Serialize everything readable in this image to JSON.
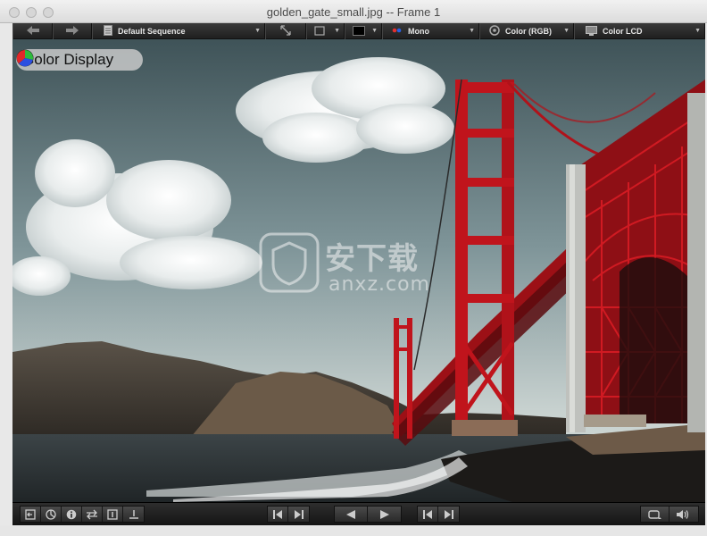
{
  "window": {
    "title": "golden_gate_small.jpg -- Frame 1"
  },
  "toolbar": {
    "sequence_label": "Default Sequence",
    "channel_label": "Mono",
    "color_mode_label": "Color (RGB)",
    "display_profile_label": "Color LCD"
  },
  "viewer": {
    "badge_label": "Color Display",
    "watermark_main": "安下载",
    "watermark_sub": "anxz.com"
  },
  "icons": {
    "back": "arrow-left-icon",
    "forward": "arrow-right-icon",
    "sequence": "document-icon",
    "fit": "expand-icon",
    "frame": "frame-icon",
    "swatch": "color-swatch-icon",
    "channel": "rgb-dots-icon",
    "color_mode": "color-wheel-icon",
    "display": "monitor-icon",
    "volume": "speaker-icon"
  },
  "colors": {
    "bridge_red": "#c0141c",
    "toolbar_dark": "#1f1f1f"
  }
}
